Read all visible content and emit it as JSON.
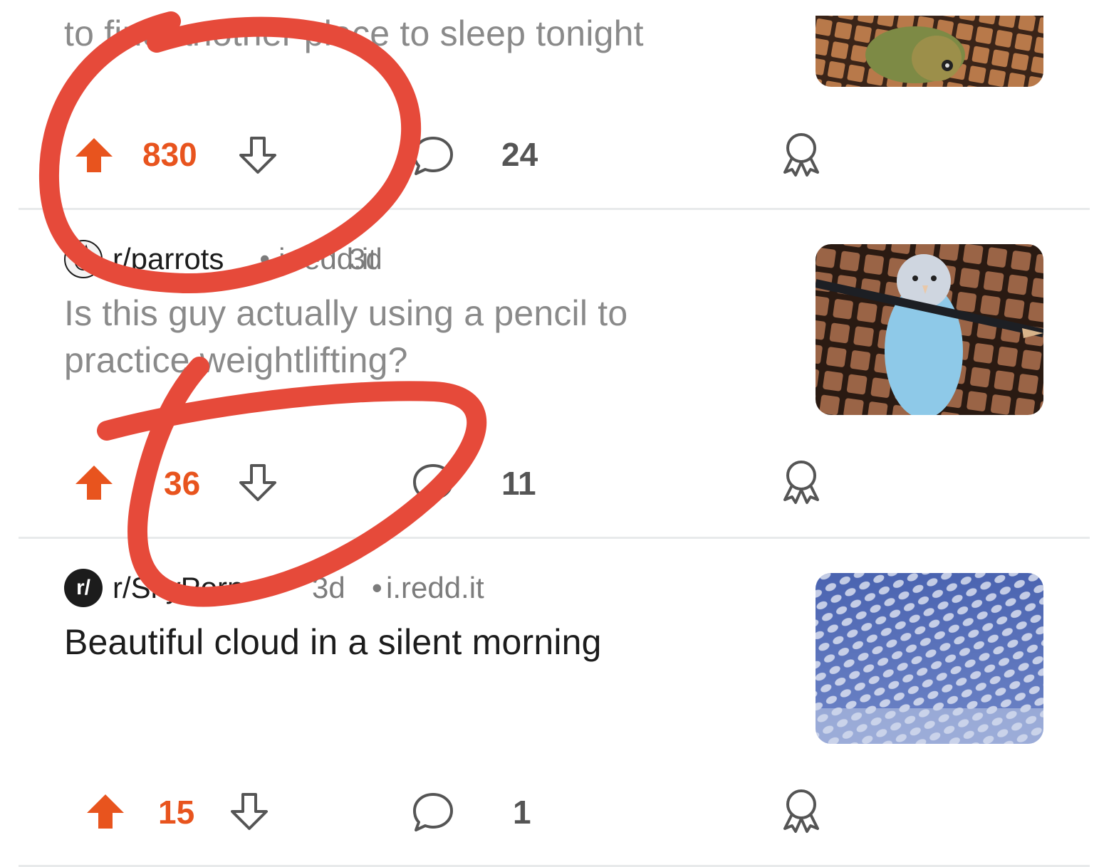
{
  "posts": [
    {
      "title": "to find another place to sleep tonight",
      "title_read": true,
      "votes": "830",
      "comments": "24"
    },
    {
      "subreddit": "r/parrots",
      "age": "3d",
      "domain": "i.redd.it",
      "title": "Is this guy actually using a pencil to practice weightlifting?",
      "title_read": true,
      "votes": "36",
      "comments": "11"
    },
    {
      "subreddit": "r/SkyPorn",
      "age": "3d",
      "domain": "i.redd.it",
      "title": "Beautiful cloud in a silent morning",
      "title_read": false,
      "votes": "15",
      "comments": "1"
    }
  ],
  "meta_separator": "•",
  "generic_avatar_label": "r/",
  "colors": {
    "upvote_active": "#e8541e",
    "annotation_red": "#e64a3a",
    "read_title": "#8a8a8a",
    "insights_gradient": [
      "#7fb7ff",
      "#c07cff"
    ]
  },
  "icons": [
    "upvote-icon",
    "downvote-icon",
    "comment-icon",
    "award-icon",
    "insights-icon"
  ]
}
